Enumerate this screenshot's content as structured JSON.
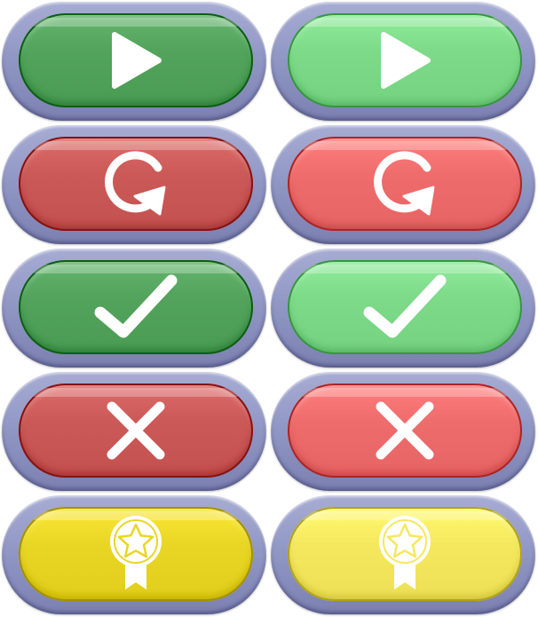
{
  "sheet": {
    "description_free": true
  },
  "palette": {
    "frame": "#959bc8",
    "frame_dark": "#6f74a6",
    "green_dark": "#52a35b",
    "green_light": "#7dda88",
    "red_dark": "#cb5957",
    "red_light": "#ef6c6c",
    "yellow_dark": "#e9d624",
    "yellow_light": "#f5e85e",
    "glyph": "#ffffff"
  },
  "buttons": [
    {
      "id": "play-button-dark",
      "icon": "play-icon",
      "tone": "green_dark"
    },
    {
      "id": "play-button-light",
      "icon": "play-icon",
      "tone": "green_light"
    },
    {
      "id": "restart-button-dark",
      "icon": "restart-icon",
      "tone": "red_dark"
    },
    {
      "id": "restart-button-light",
      "icon": "restart-icon",
      "tone": "red_light"
    },
    {
      "id": "confirm-button-dark",
      "icon": "checkmark-icon",
      "tone": "green_dark"
    },
    {
      "id": "confirm-button-light",
      "icon": "checkmark-icon",
      "tone": "green_light"
    },
    {
      "id": "cancel-button-dark",
      "icon": "close-icon",
      "tone": "red_dark"
    },
    {
      "id": "cancel-button-light",
      "icon": "close-icon",
      "tone": "red_light"
    },
    {
      "id": "award-button-dark",
      "icon": "award-ribbon-icon",
      "tone": "yellow_dark"
    },
    {
      "id": "award-button-light",
      "icon": "award-ribbon-icon",
      "tone": "yellow_light"
    }
  ]
}
